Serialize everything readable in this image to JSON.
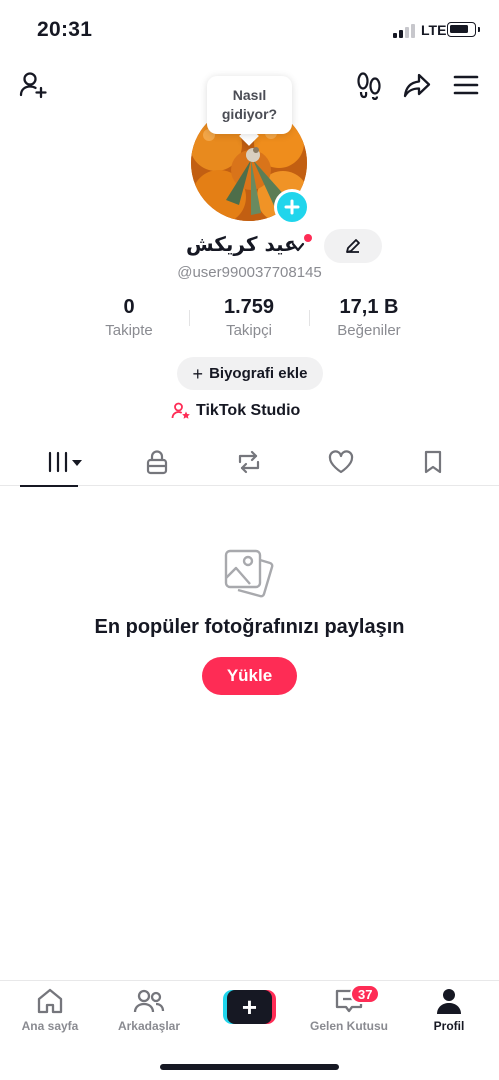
{
  "status_bar": {
    "time": "20:31",
    "network": "LTE"
  },
  "profile": {
    "prompt_bubble": {
      "line1": "Nasıl",
      "line2": "gidiyor?"
    },
    "display_name": "عيد كريكش",
    "handle": "@user990037708145",
    "stats": [
      {
        "value": "0",
        "label": "Takipte"
      },
      {
        "value": "1.759",
        "label": "Takipçi"
      },
      {
        "value": "17,1 B",
        "label": "Beğeniler"
      }
    ],
    "bio_button": "Biyografi ekle",
    "studio_link": "TikTok Studio"
  },
  "empty_state": {
    "title": "En popüler fotoğrafınızı paylaşın",
    "upload_label": "Yükle"
  },
  "bottom_nav": {
    "home": "Ana sayfa",
    "friends": "Arkadaşlar",
    "create": "+",
    "inbox": "Gelen Kutusu",
    "inbox_badge": "37",
    "profile": "Profil"
  },
  "colors": {
    "accent": "#fe2c55",
    "cyan": "#20d5ec",
    "text": "#161823",
    "muted": "#8a8b91"
  }
}
